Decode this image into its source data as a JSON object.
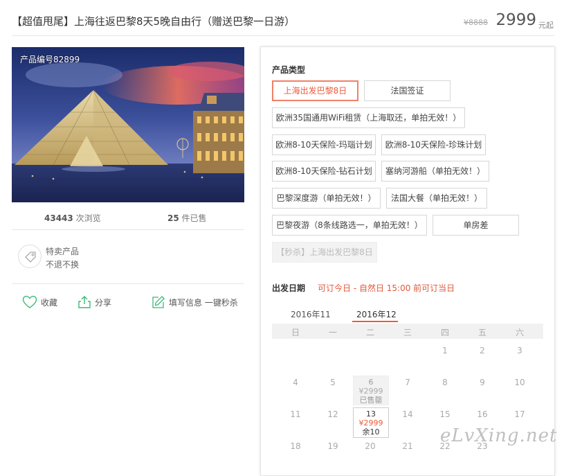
{
  "header": {
    "title": "【超值甩尾】上海往返巴黎8天5晚自由行（赠送巴黎一日游）",
    "old_price": "¥8888",
    "price": "2999",
    "price_unit": "元起"
  },
  "photo": {
    "product_id": "产品编号82899"
  },
  "stats": {
    "views_count": "43443",
    "views_label": " 次浏览",
    "sold_count": "25",
    "sold_label": " 件已售"
  },
  "promo": {
    "line1": "特卖产品",
    "line2": "不退不换"
  },
  "actions": {
    "favorite": "收藏",
    "share": "分享",
    "fill_info": "填写信息 一键秒杀"
  },
  "product_type": {
    "label": "产品类型",
    "options": [
      "上海出发巴黎8日",
      "法国签证",
      "欧洲35国通用WiFi租赁（上海取还，单拍无效！）",
      "欧洲8-10天保险-玛瑙计划",
      "欧洲8-10天保险-珍珠计划",
      "欧洲8-10天保险-钻石计划",
      "塞纳河游船（单拍无效！）",
      "巴黎深度游（单拍无效！）",
      "法国大餐（单拍无效！）",
      "巴黎夜游（8条线路选一，单拍无效！）",
      "单房差",
      "【秒杀】上海出发巴黎8日"
    ],
    "selected": "上海出发巴黎8日"
  },
  "departure": {
    "label": "出发日期",
    "note": "可订今日 - 自然日 15:00 前可订当日"
  },
  "calendar": {
    "months": [
      "2016年11",
      "2016年12"
    ],
    "active_month": "2016年12",
    "weekdays": [
      "日",
      "一",
      "二",
      "三",
      "四",
      "五",
      "六"
    ],
    "row1": [
      "1",
      "2",
      "3"
    ],
    "row2": [
      "4",
      "5",
      "6",
      "7",
      "8",
      "9",
      "10"
    ],
    "row3": [
      "11",
      "12",
      "13",
      "14",
      "15",
      "16",
      "17"
    ],
    "row4": [
      "18",
      "19",
      "20",
      "21",
      "22",
      "23"
    ],
    "day6": {
      "price": "¥2999",
      "status": "已售罄"
    },
    "day13": {
      "price": "¥2999",
      "status": "余10"
    }
  },
  "watermark": "eLvXing.net",
  "colors": {
    "accent": "#ee5a3a",
    "border": "#d6d6d6",
    "calendar_header_bg": "#f1f1f1"
  }
}
